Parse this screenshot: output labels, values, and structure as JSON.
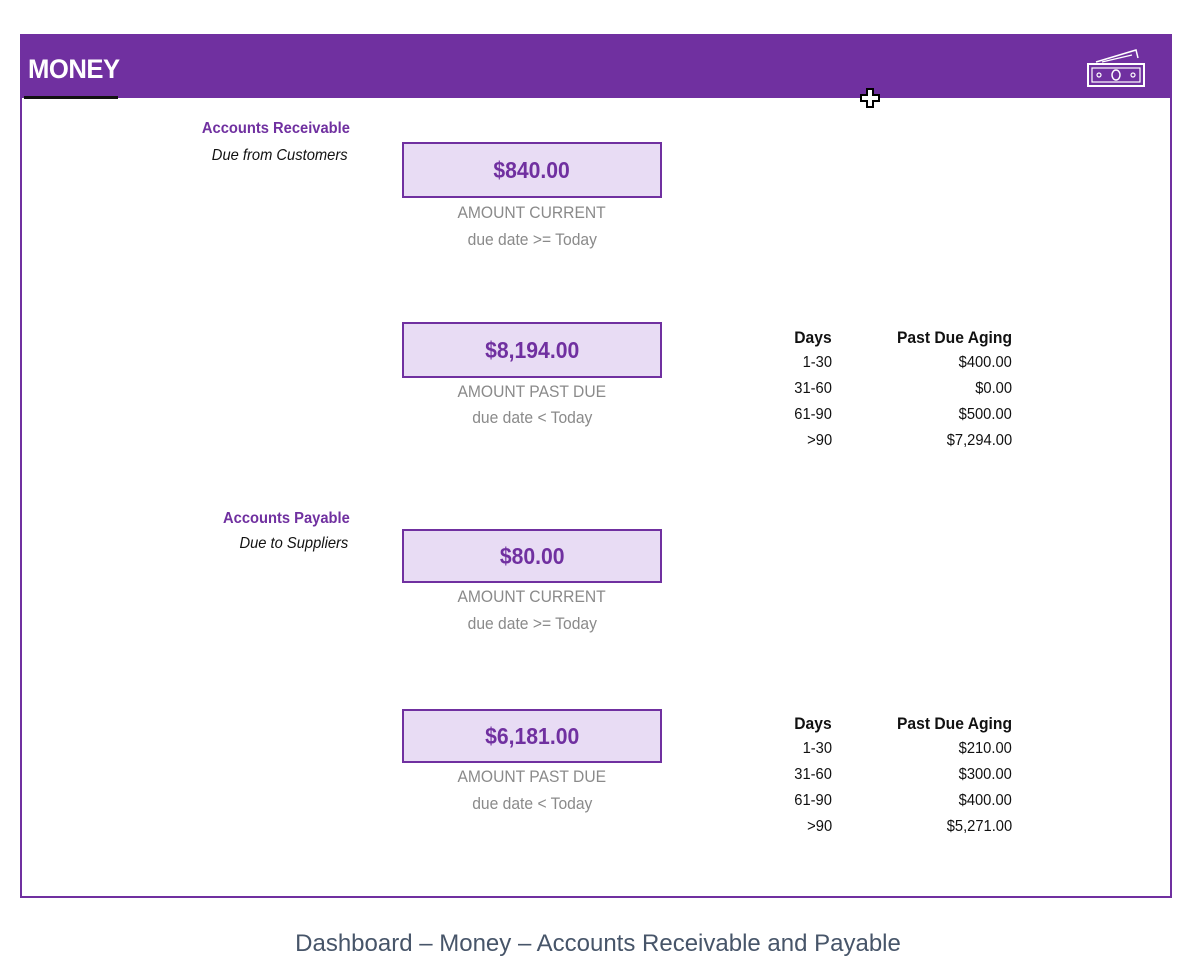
{
  "header": {
    "title": "MONEY"
  },
  "receivable": {
    "title": "Accounts Receivable",
    "subtitle": "Due from Customers",
    "current": {
      "amount": "$840.00",
      "label": "AMOUNT CURRENT",
      "condition": "due date >= Today"
    },
    "past_due": {
      "amount": "$8,194.00",
      "label": "AMOUNT PAST DUE",
      "condition": "due date < Today"
    },
    "aging": {
      "headers": [
        "Days",
        "Past Due Aging"
      ],
      "rows": [
        [
          "1-30",
          "$400.00"
        ],
        [
          "31-60",
          "$0.00"
        ],
        [
          "61-90",
          "$500.00"
        ],
        [
          ">90",
          "$7,294.00"
        ]
      ]
    }
  },
  "payable": {
    "title": "Accounts Payable",
    "subtitle": "Due to Suppliers",
    "current": {
      "amount": "$80.00",
      "label": "AMOUNT CURRENT",
      "condition": "due date >= Today"
    },
    "past_due": {
      "amount": "$6,181.00",
      "label": "AMOUNT PAST DUE",
      "condition": "due date < Today"
    },
    "aging": {
      "headers": [
        "Days",
        "Past Due Aging"
      ],
      "rows": [
        [
          "1-30",
          "$210.00"
        ],
        [
          "31-60",
          "$300.00"
        ],
        [
          "61-90",
          "$400.00"
        ],
        [
          ">90",
          "$5,271.00"
        ]
      ]
    }
  },
  "caption": "Dashboard – Money – Accounts Receivable and Payable",
  "colors": {
    "accent": "#7030a0",
    "box_fill": "#e8dcf4",
    "muted_text": "#8a8a8a"
  },
  "icons": {
    "header_icon": "money-bill-icon",
    "cursor": "move-cursor-icon"
  }
}
